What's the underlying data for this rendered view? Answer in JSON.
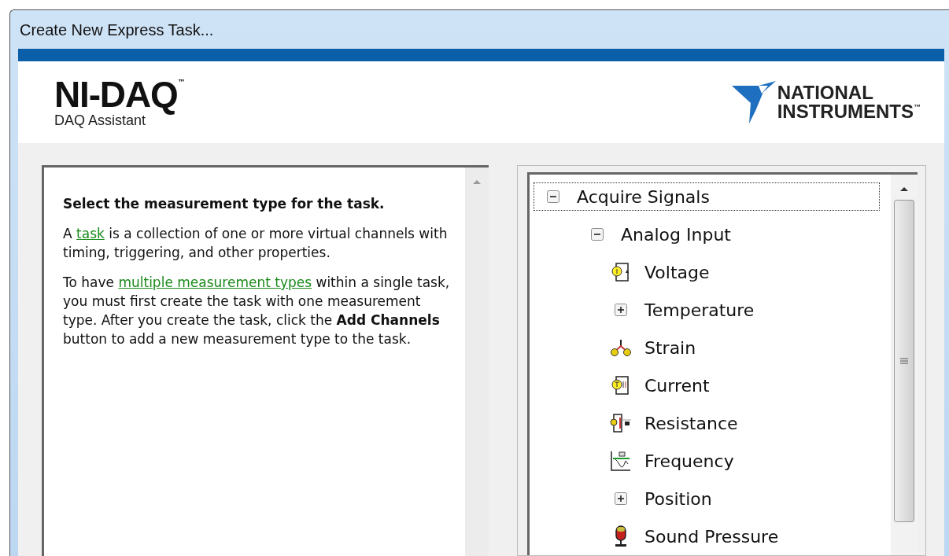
{
  "window": {
    "title": "Create New Express Task..."
  },
  "header": {
    "product": "NI-DAQ",
    "product_mark": "™",
    "subtitle": "DAQ Assistant",
    "company_line_1": "NATIONAL",
    "company_line_2": "INSTRUMENTS",
    "company_mark": "™"
  },
  "help": {
    "heading": "Select the measurement type for the task.",
    "paragraphs": [
      [
        {
          "kind": "text",
          "text": "A "
        },
        {
          "kind": "link",
          "text": "task"
        },
        {
          "kind": "text",
          "text": " is a collection of one or more virtual channels with timing, triggering, and other properties."
        }
      ],
      [
        {
          "kind": "text",
          "text": "To have "
        },
        {
          "kind": "link",
          "text": "multiple measurement types"
        },
        {
          "kind": "text",
          "text": " within a single task, you must first create the task with one measurement type. After you create the task, click the **Add Channels** button to add a new measurement type to the task."
        }
      ]
    ]
  },
  "tree": [
    {
      "label": "Acquire Signals",
      "expanded": true,
      "focused": true,
      "children": [
        {
          "label": "Analog Input",
          "expanded": true,
          "focused": false,
          "children": [
            {
              "label": "Voltage"
            },
            {
              "label": "Temperature",
              "expanded": false,
              "focused": false
            },
            {
              "label": "Strain"
            },
            {
              "label": "Current"
            },
            {
              "label": "Resistance"
            },
            {
              "label": "Frequency"
            },
            {
              "label": "Position",
              "expanded": false,
              "focused": false
            },
            {
              "label": "Sound Pressure"
            }
          ]
        }
      ]
    }
  ]
}
